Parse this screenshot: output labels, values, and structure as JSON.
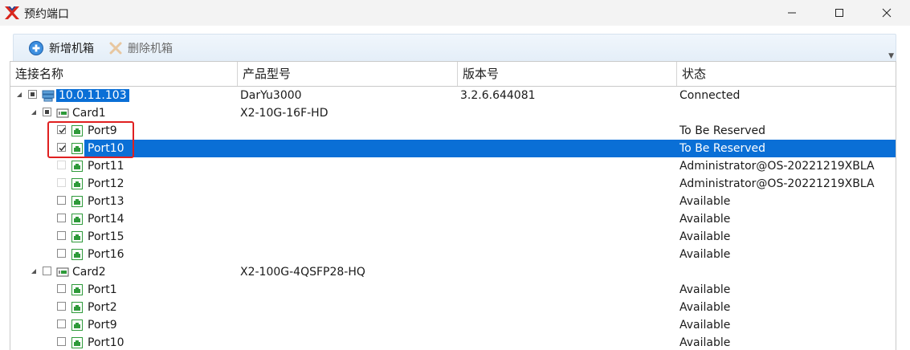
{
  "window": {
    "title": "预约端口"
  },
  "toolbar": {
    "add_label": "新增机箱",
    "delete_label": "删除机箱"
  },
  "columns": [
    "连接名称",
    "产品型号",
    "版本号",
    "状态"
  ],
  "colors": {
    "selection": "#0a6fd6",
    "port_icon": "#2e9a3a",
    "highlight_box": "#e02020"
  },
  "tree": {
    "chassis": {
      "name": "10.0.11.103",
      "model": "DarYu3000",
      "version": "3.2.6.644081",
      "status": "Connected"
    },
    "card1": {
      "name": "Card1",
      "model": "X2-10G-16F-HD",
      "ports": [
        {
          "name": "Port9",
          "status": "To Be Reserved"
        },
        {
          "name": "Port10",
          "status": "To Be Reserved"
        },
        {
          "name": "Port11",
          "status": "Administrator@OS-20221219XBLA"
        },
        {
          "name": "Port12",
          "status": "Administrator@OS-20221219XBLA"
        },
        {
          "name": "Port13",
          "status": "Available"
        },
        {
          "name": "Port14",
          "status": "Available"
        },
        {
          "name": "Port15",
          "status": "Available"
        },
        {
          "name": "Port16",
          "status": "Available"
        }
      ]
    },
    "card2": {
      "name": "Card2",
      "model": "X2-100G-4QSFP28-HQ",
      "ports": [
        {
          "name": "Port1",
          "status": "Available"
        },
        {
          "name": "Port2",
          "status": "Available"
        },
        {
          "name": "Port9",
          "status": "Available"
        },
        {
          "name": "Port10",
          "status": "Available"
        }
      ]
    }
  }
}
